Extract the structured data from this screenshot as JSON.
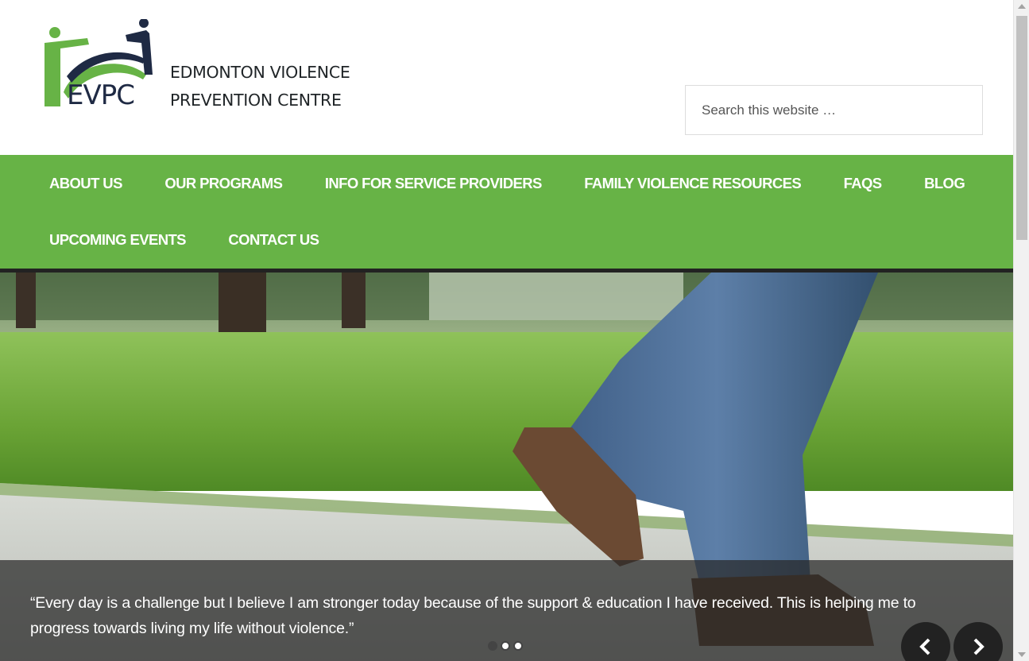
{
  "site": {
    "logo_letters": "EVPC",
    "name_line1": "EDMONTON VIOLENCE",
    "name_line2": "PREVENTION CENTRE"
  },
  "search": {
    "placeholder": "Search this website …"
  },
  "nav": {
    "row1": [
      {
        "label": "ABOUT US"
      },
      {
        "label": "OUR PROGRAMS"
      },
      {
        "label": "INFO FOR SERVICE PROVIDERS"
      },
      {
        "label": "FAMILY VIOLENCE RESOURCES"
      },
      {
        "label": "FAQS"
      },
      {
        "label": "BLOG"
      }
    ],
    "row2": [
      {
        "label": "UPCOMING EVENTS"
      },
      {
        "label": "CONTACT US"
      }
    ]
  },
  "slider": {
    "caption": "“Every day is a challenge but I believe I am stronger today because of the support & education I have received. This is helping me to progress towards living my life without violence.”",
    "dots": 3,
    "active_dot": 0
  },
  "colors": {
    "brand_green": "#67b346",
    "brand_navy": "#1f2a44",
    "nav_text": "#ffffff"
  },
  "icons": {
    "prev": "chevron-left-icon",
    "next": "chevron-right-icon"
  }
}
